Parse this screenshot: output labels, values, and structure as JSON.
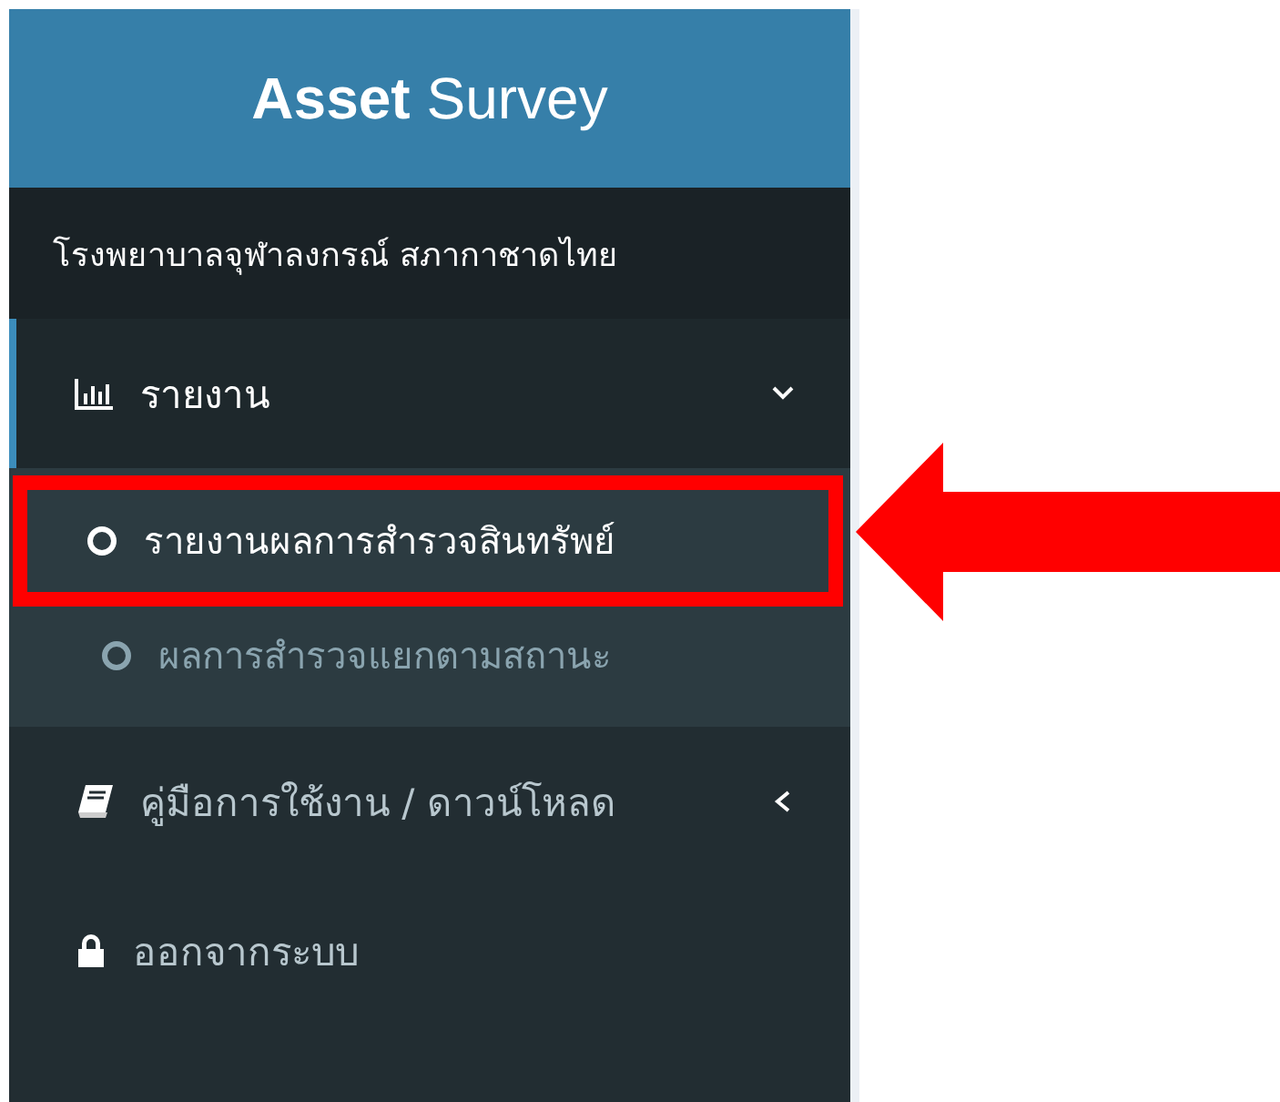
{
  "header": {
    "title": "**Asset** Survey"
  },
  "organization": "โรงพยาบาลจุฬาลงกรณ์ สภากาชาดไทย",
  "menu": [
    {
      "kind": "group",
      "label": "รายงาน",
      "active": true,
      "expanded": true,
      "children": [
        {
          "label": "รายงานผลการสำรวจสินทรัพย์",
          "selected": true,
          "highlighted": true
        },
        {
          "label": "ผลการสำรวจแยกตามสถานะ",
          "selected": false,
          "highlighted": false
        }
      ]
    },
    {
      "kind": "group",
      "label": "คู่มือการใช้งาน / ดาวน์โหลด",
      "active": false,
      "expanded": false
    },
    {
      "kind": "logout",
      "label": "ออกจากระบบ",
      "active": false
    }
  ]
}
